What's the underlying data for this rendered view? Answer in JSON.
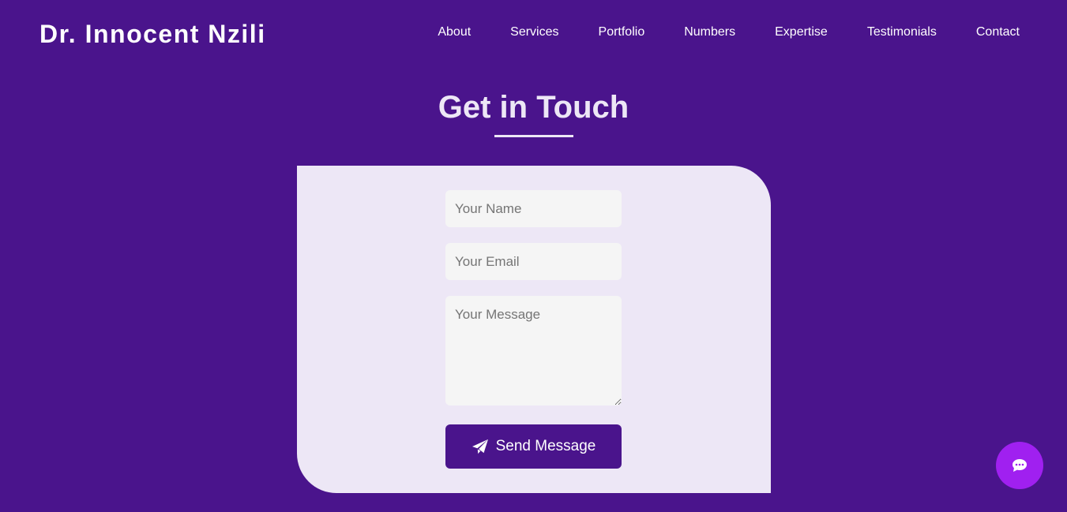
{
  "header": {
    "brand": "Dr. Innocent Nzili",
    "nav": [
      "About",
      "Services",
      "Portfolio",
      "Numbers",
      "Expertise",
      "Testimonials",
      "Contact"
    ]
  },
  "contact": {
    "title": "Get in Touch",
    "name_placeholder": "Your Name",
    "email_placeholder": "Your Email",
    "message_placeholder": "Your Message",
    "send_label": "Send Message",
    "send_icon": "paper-plane-icon"
  },
  "chat_button": {
    "icon": "chat-icon"
  },
  "colors": {
    "background": "#4a148c",
    "card": "#ede7f6",
    "field": "#f5f5f5",
    "button": "#4a148c",
    "chat_button": "#a020f0",
    "text_light": "#ffffff"
  }
}
